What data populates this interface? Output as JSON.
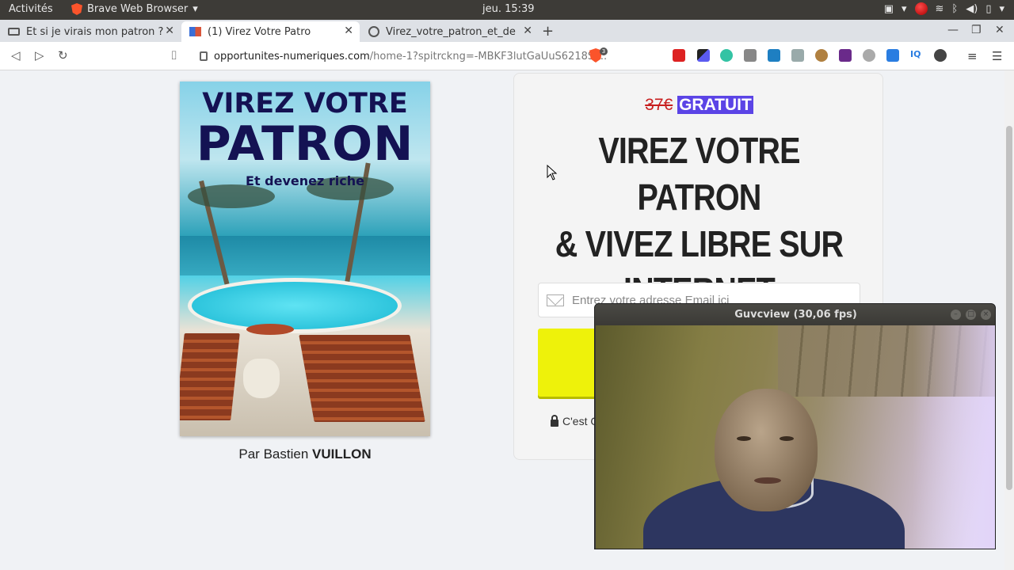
{
  "topbar": {
    "activities": "Activités",
    "app_name": "Brave Web Browser",
    "clock": "jeu. 15:39"
  },
  "tabs": [
    {
      "label": "Et si je virais mon patron ?",
      "icon": "laptop-icon",
      "active": false
    },
    {
      "label": "(1) Virez Votre Patro",
      "icon": "site-favicon",
      "active": true
    },
    {
      "label": "Virez_votre_patron_et_de",
      "icon": "globe-icon",
      "active": false
    }
  ],
  "address": {
    "host": "opportunites-numeriques.com",
    "path": "/home-1?spitrckng=-MBKF3lutGaUuS6218Sj...",
    "shield_count": "3"
  },
  "book": {
    "title_line1": "VIREZ VOTRE",
    "title_line2": "PATRON",
    "subtitle": "Et devenez riche",
    "author_prefix": "Par Bastien ",
    "author_name": "VUILLON"
  },
  "offer": {
    "old_price": "37€",
    "new_price": "GRATUIT",
    "headline_line1": "VIREZ VOTRE PATRON",
    "headline_line2": "& VIVEZ LIBRE SUR",
    "headline_line3": "INTERNET",
    "email_placeholder": "Entrez votre adresse Email ici",
    "secure_text": "C'est G"
  },
  "webcam": {
    "title": "Guvcview  (30,06 fps)"
  },
  "colors": {
    "accent_purple": "#5b44e6",
    "cta_yellow": "#eef20a",
    "old_price_red": "#c81e1e",
    "cover_navy": "#141253"
  }
}
